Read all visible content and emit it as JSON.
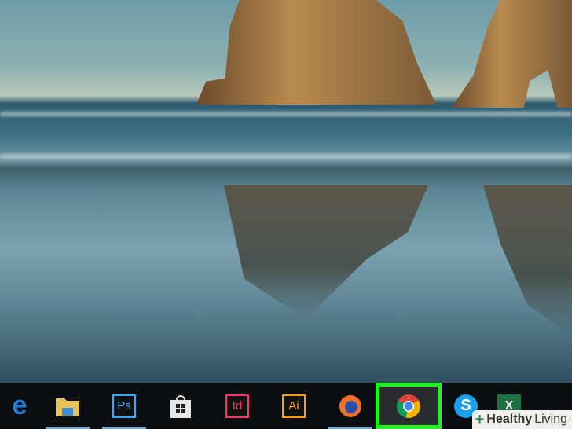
{
  "taskbar": {
    "apps": [
      {
        "name": "Microsoft Edge",
        "icon": "edge-icon"
      },
      {
        "name": "File Explorer",
        "icon": "folder-icon"
      },
      {
        "name": "Photoshop",
        "icon": "photoshop-icon",
        "label": "Ps",
        "color": "#31a8ff"
      },
      {
        "name": "Microsoft Store",
        "icon": "store-icon"
      },
      {
        "name": "InDesign",
        "icon": "indesign-icon",
        "label": "Id",
        "color": "#ff3366"
      },
      {
        "name": "Illustrator",
        "icon": "illustrator-icon",
        "label": "Ai",
        "color": "#ff9a00"
      },
      {
        "name": "Firefox",
        "icon": "firefox-icon"
      },
      {
        "name": "Google Chrome",
        "icon": "chrome-icon",
        "highlighted": true
      },
      {
        "name": "Skype",
        "icon": "skype-icon"
      },
      {
        "name": "Excel",
        "icon": "excel-icon",
        "label": "X"
      }
    ]
  },
  "highlight_color": "#25f023",
  "watermark": {
    "bold": "Healthy",
    "light": "Living"
  }
}
